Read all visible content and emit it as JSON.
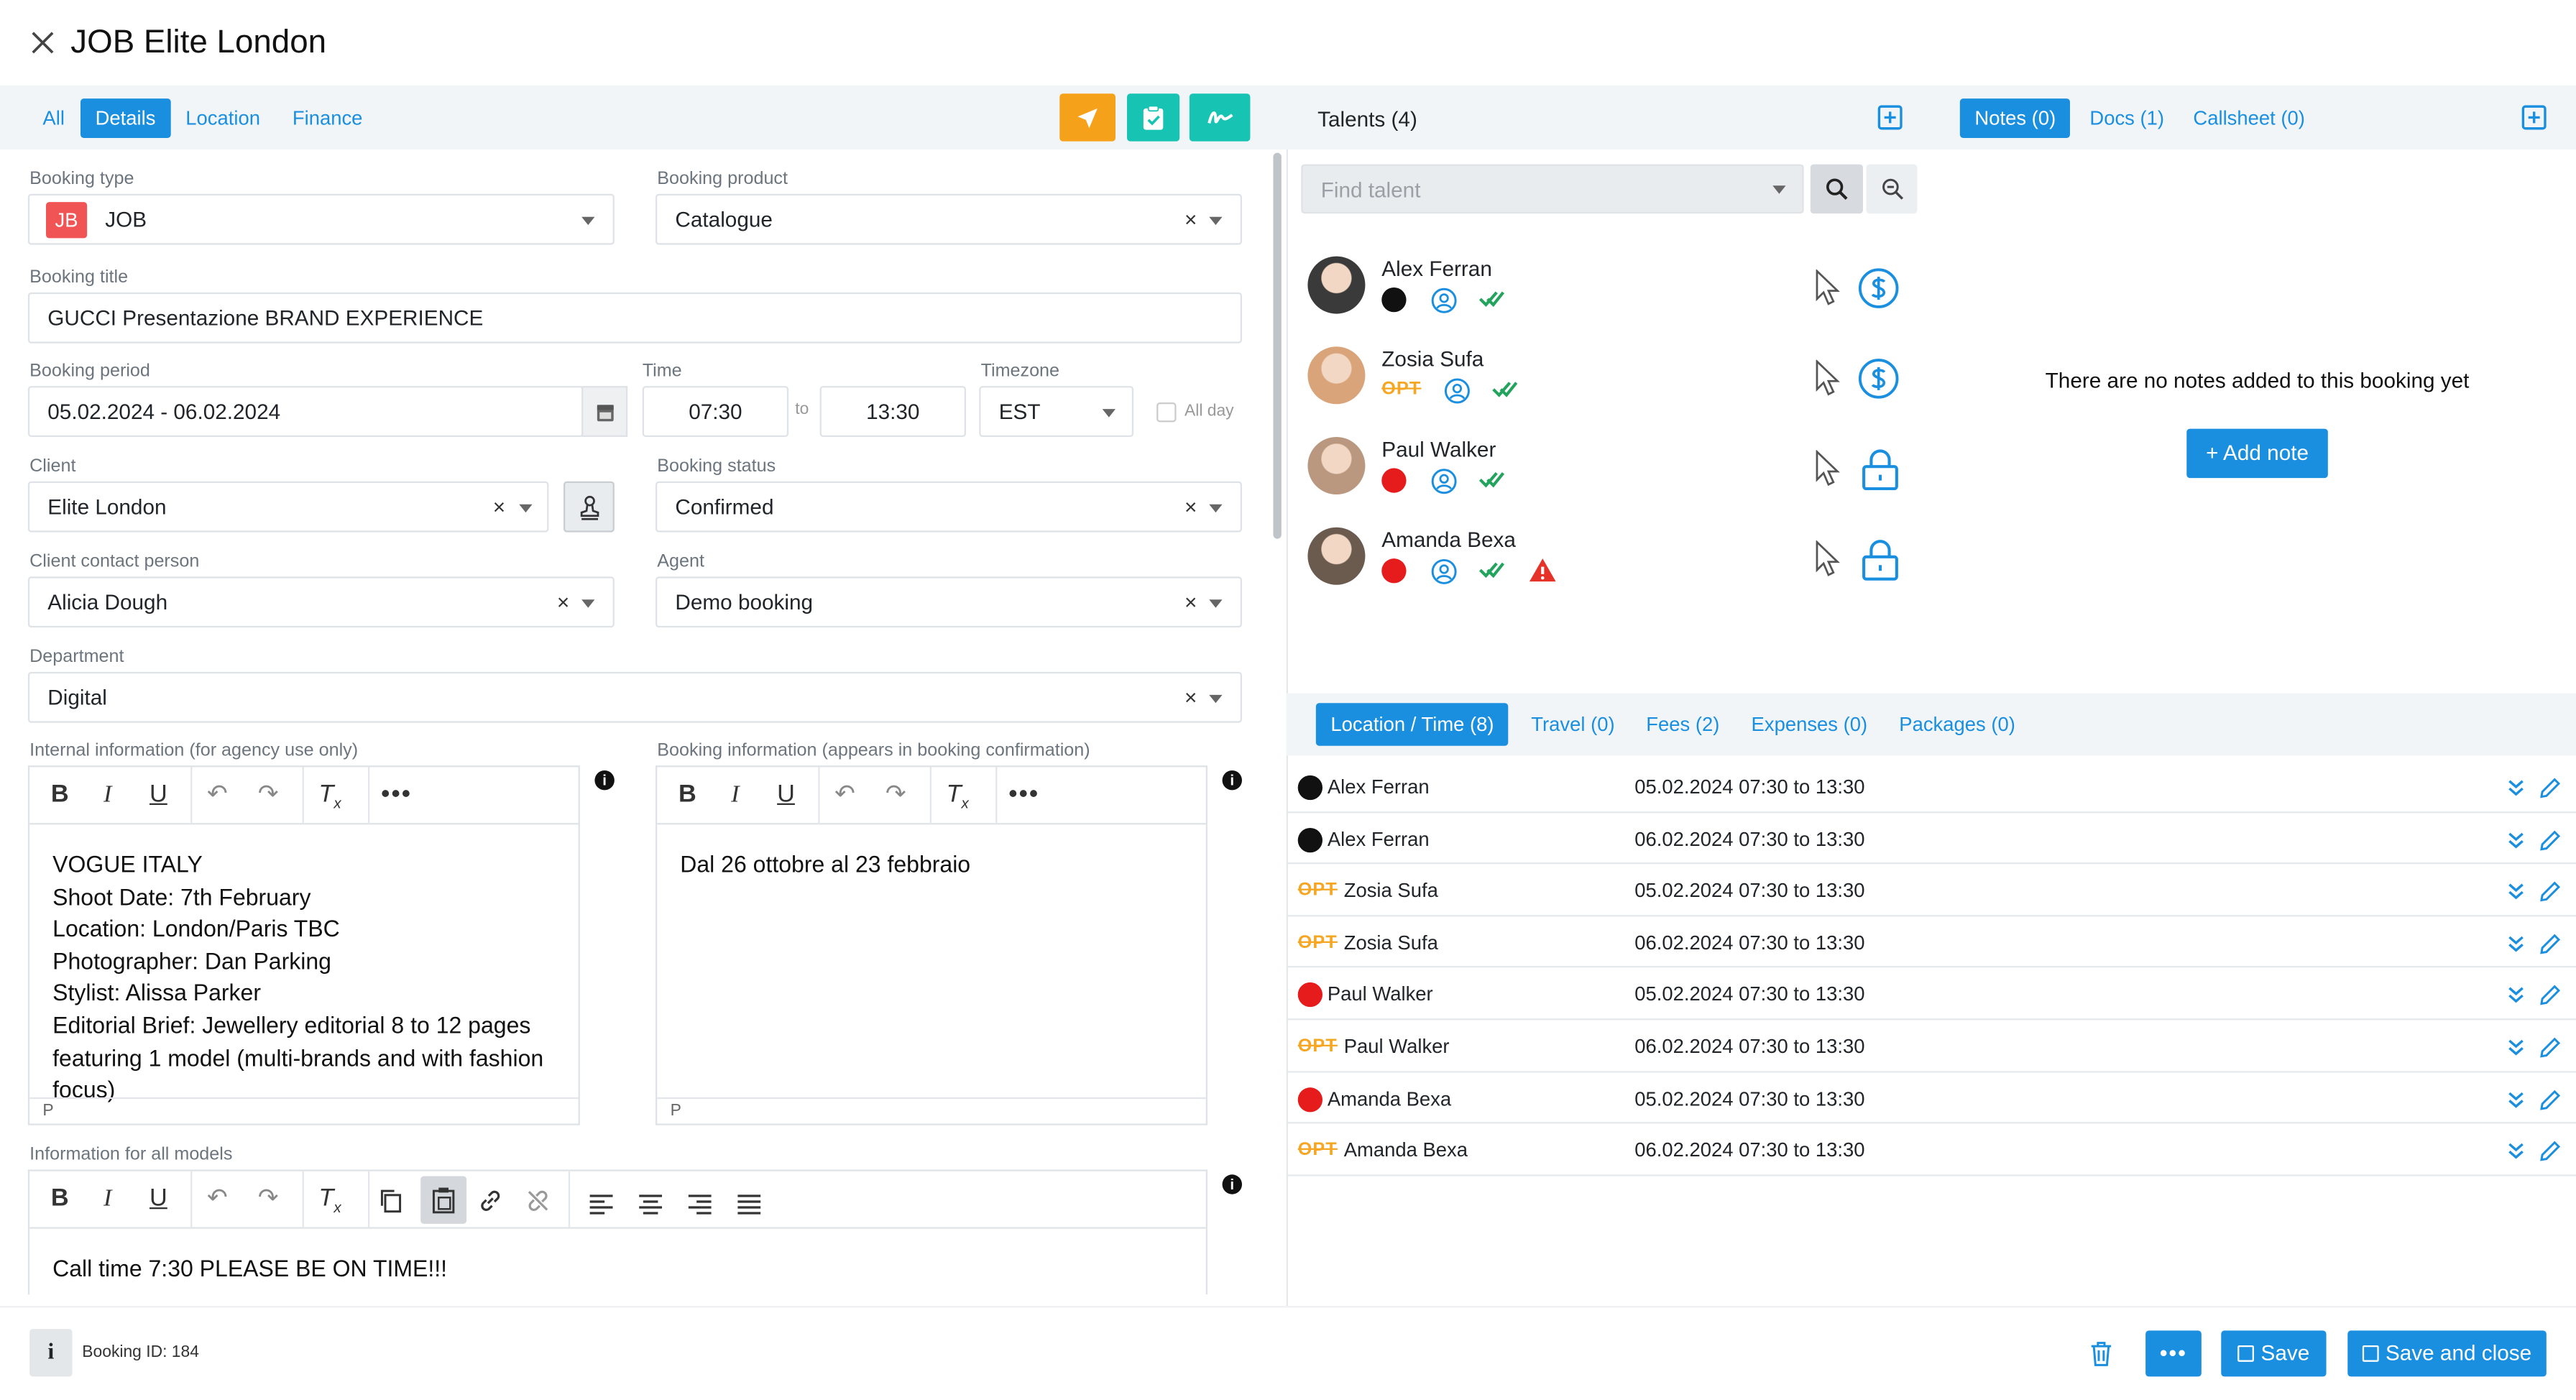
{
  "window": {
    "title": "JOB Elite London"
  },
  "tabs": [
    "All",
    "Details",
    "Location",
    "Finance"
  ],
  "form": {
    "booking_type": {
      "label": "Booking type",
      "badge": "JB",
      "value": "JOB"
    },
    "booking_product": {
      "label": "Booking product",
      "value": "Catalogue"
    },
    "booking_title": {
      "label": "Booking title",
      "value": "GUCCI Presentazione BRAND EXPERIENCE"
    },
    "booking_period": {
      "label": "Booking period",
      "value": "05.02.2024 - 06.02.2024"
    },
    "time": {
      "label": "Time",
      "from": "07:30",
      "to_label": "to",
      "to": "13:30"
    },
    "timezone": {
      "label": "Timezone",
      "value": "EST"
    },
    "all_day": {
      "label": "All day"
    },
    "client": {
      "label": "Client",
      "value": "Elite London"
    },
    "booking_status": {
      "label": "Booking status",
      "value": "Confirmed"
    },
    "client_contact": {
      "label": "Client contact person",
      "value": "Alicia Dough"
    },
    "agent": {
      "label": "Agent",
      "value": "Demo booking"
    },
    "department": {
      "label": "Department",
      "value": "Digital"
    },
    "internal_info": {
      "label": "Internal information (for agency use only)",
      "text": "VOGUE ITALY\nShoot Date: 7th February\nLocation: London/Paris TBC\nPhotographer: Dan Parking\nStylist: Alissa Parker\nEditorial Brief: Jewellery editorial 8 to 12 pages featuring 1 model (multi-brands and with fashion focus)",
      "status": "P"
    },
    "booking_info": {
      "label": "Booking information (appears in booking confirmation)",
      "text": "Dal 26 ottobre al 23 febbraio",
      "status": "P"
    },
    "models_info": {
      "label": "Information for all models",
      "text": "Call time 7:30 PLEASE BE ON TIME!!!"
    }
  },
  "talents": {
    "header": "Talents (4)",
    "search_placeholder": "Find talent",
    "items": [
      {
        "name": "Alex Ferran",
        "status": "black",
        "opt": "",
        "warning": false,
        "action": "dollar"
      },
      {
        "name": "Zosia Sufa",
        "status": "opt",
        "opt": "OPT",
        "warning": false,
        "action": "dollar"
      },
      {
        "name": "Paul Walker",
        "status": "red",
        "opt": "",
        "warning": false,
        "action": "lock"
      },
      {
        "name": "Amanda Bexa",
        "status": "red",
        "opt": "",
        "warning": true,
        "action": "lock"
      }
    ]
  },
  "notes": {
    "tabs": [
      "Notes (0)",
      "Docs (1)",
      "Callsheet (0)"
    ],
    "empty_text": "There are no notes added to this booking yet",
    "add_label": "+ Add note"
  },
  "schedule": {
    "tabs": [
      "Location / Time (8)",
      "Travel (0)",
      "Fees (2)",
      "Expenses (0)",
      "Packages (0)"
    ],
    "rows": [
      {
        "status": "black",
        "opt": "",
        "name": "Alex Ferran",
        "time": "05.02.2024 07:30 to 13:30"
      },
      {
        "status": "black",
        "opt": "",
        "name": "Alex Ferran",
        "time": "06.02.2024 07:30 to 13:30"
      },
      {
        "status": "opt",
        "opt": "OPT",
        "name": "Zosia Sufa",
        "time": "05.02.2024 07:30 to 13:30"
      },
      {
        "status": "opt",
        "opt": "OPT",
        "name": "Zosia Sufa",
        "time": "06.02.2024 07:30 to 13:30"
      },
      {
        "status": "red",
        "opt": "",
        "name": "Paul Walker",
        "time": "05.02.2024 07:30 to 13:30"
      },
      {
        "status": "opt",
        "opt": "OPT",
        "name": "Paul Walker",
        "time": "06.02.2024 07:30 to 13:30"
      },
      {
        "status": "red",
        "opt": "",
        "name": "Amanda Bexa",
        "time": "05.02.2024 07:30 to 13:30"
      },
      {
        "status": "opt",
        "opt": "OPT",
        "name": "Amanda Bexa",
        "time": "06.02.2024 07:30 to 13:30"
      }
    ]
  },
  "footer": {
    "booking_id": "Booking ID: 184",
    "save_label": "Save",
    "save_close_label": "Save and close"
  },
  "colors": {
    "accent": "#1a8fe0",
    "orange": "#f5a11a",
    "teal": "#17c3b2",
    "red": "#e61b1b",
    "opt": "#f5a623",
    "green": "#22a45d"
  }
}
